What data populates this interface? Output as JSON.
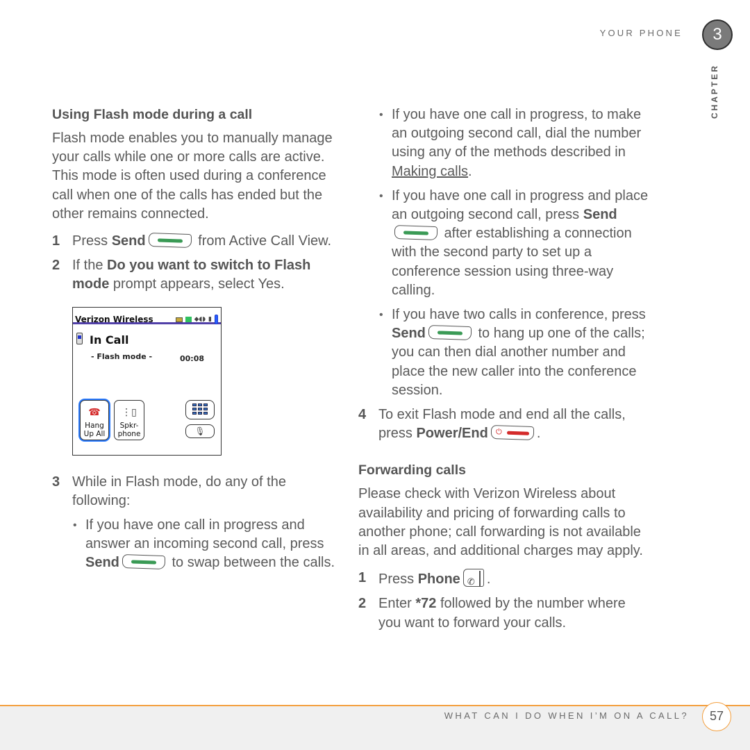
{
  "header": {
    "running_head": "YOUR PHONE",
    "chapter_number": "3",
    "chapter_label": "CHAPTER"
  },
  "left_column": {
    "section_title": "Using Flash mode during a call",
    "intro": "Flash mode enables you to manually manage your calls while one or more calls are active. This mode is often used during a conference call when one of the calls has ended but the other remains connected.",
    "steps": [
      {
        "num": "1",
        "pre": "Press ",
        "bold": "Send",
        "icon": "send-key-icon",
        "post": " from Active Call View."
      },
      {
        "num": "2",
        "pre": "If the ",
        "bold": "Do you want to switch to Flash mode",
        "post": " prompt appears, select Yes."
      },
      {
        "num": "3",
        "text": "While in Flash mode, do any of the following:"
      }
    ],
    "bullet_1": {
      "pre": "If you have one call in progress and answer an incoming second call, press ",
      "bold": "Send",
      "post": " to swap between the calls."
    }
  },
  "device_screen": {
    "carrier": "Verizon Wireless",
    "title": "In Call",
    "mode": "- Flash mode -",
    "timer": "00:08",
    "buttons": [
      {
        "label_1": "Hang",
        "label_2": "Up All",
        "icon": "phone-hangup-icon"
      },
      {
        "label_1": "Spkr-",
        "label_2": "phone",
        "icon": "speakerphone-icon"
      }
    ],
    "keypad_icon": "keypad-icon",
    "mic_icon": "microphone-icon"
  },
  "right_column": {
    "bullet_2": {
      "pre": "If you have one call in progress, to make an outgoing second call, dial the number using any of the methods described in ",
      "link": "Making calls",
      "post": "."
    },
    "bullet_3": {
      "pre": "If you have one call in progress and place an outgoing second call, press ",
      "bold": "Send",
      "post": " after establishing a connection with the second party to set up a conference session using three-way calling."
    },
    "bullet_4": {
      "pre": "If you have two calls in conference, press ",
      "bold": "Send",
      "post": " to hang up one of the calls; you can then dial another number and place the new caller into the conference session."
    },
    "step_4": {
      "num": "4",
      "pre": "To exit Flash mode and end all the calls, press ",
      "bold": "Power/End",
      "post": "."
    },
    "section_title": "Forwarding calls",
    "forward_intro": "Please check with Verizon Wireless about availability and pricing of forwarding calls to another phone; call forwarding is not available in all areas, and additional charges may apply.",
    "fwd_step_1": {
      "num": "1",
      "pre": "Press ",
      "bold": "Phone",
      "post": "."
    },
    "fwd_step_2": {
      "num": "2",
      "pre": " Enter ",
      "bold": "*72",
      "post": " followed by the number where you want to forward your calls."
    }
  },
  "footer": {
    "section": "WHAT CAN I DO WHEN I’M ON A CALL?",
    "page_number": "57"
  },
  "colors": {
    "accent_orange": "#f4a040",
    "send_green": "#3a9a55",
    "end_red": "#d42a2a",
    "chapter_grey": "#7a7a7a"
  }
}
